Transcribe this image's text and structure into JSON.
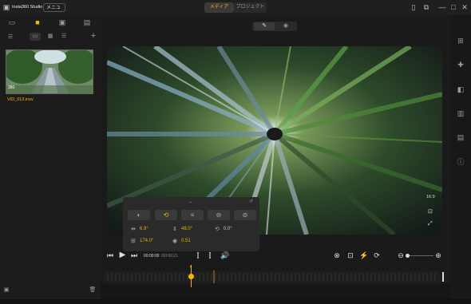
{
  "app": {
    "title": "Insta360 Studio",
    "menu_label": "メニュー"
  },
  "tabs": [
    {
      "label": "メディア",
      "active": true
    },
    {
      "label": "プロジェクト",
      "active": false
    }
  ],
  "media": {
    "filename": "VID_013.insv",
    "badge": "360"
  },
  "viewer": {
    "aspect": "16:9"
  },
  "adjust_panel": {
    "pan": "6.9°",
    "tilt": "48.0°",
    "roll": "0.0°",
    "fov": "174.0°",
    "distance": "0.51"
  },
  "playback": {
    "current_time": "00:00:00",
    "duration": "/00:00:21"
  },
  "colors": {
    "accent": "#f2b705",
    "bg": "#161616",
    "panel": "#2a2a2a"
  }
}
